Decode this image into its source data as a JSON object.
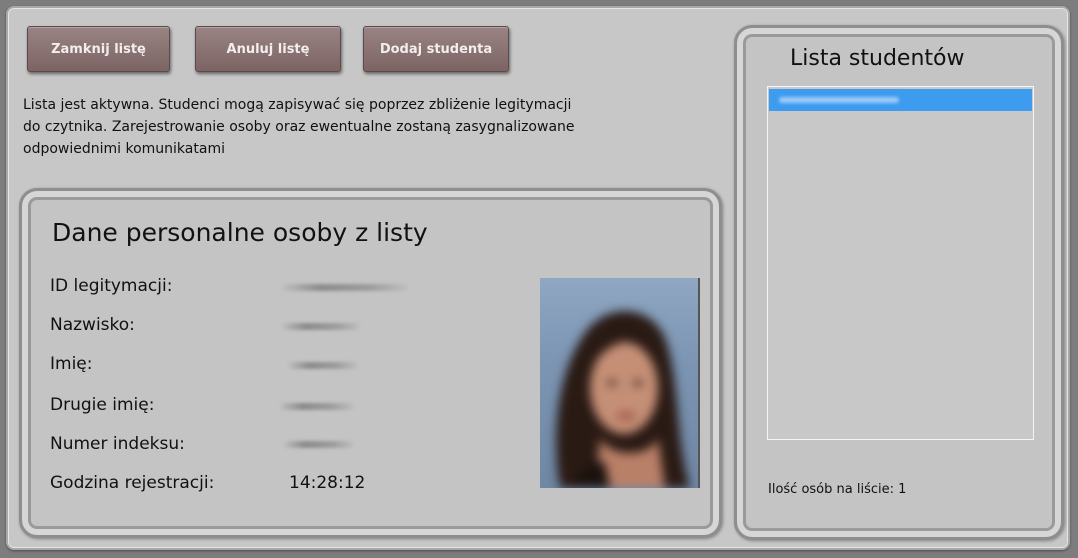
{
  "toolbar": {
    "close_list_label": "Zamknij listę",
    "cancel_list_label": "Anuluj listę",
    "add_student_label": "Dodaj studenta"
  },
  "info": {
    "line1": "Lista jest aktywna. Studenci mogą zapisywać się poprzez zbliżenie legitymacji",
    "line2": "do czytnika. Zarejestrowanie osoby oraz ewentualne zostaną zasygnalizowane",
    "line3": "odpowiednimi komunikatami"
  },
  "person": {
    "title": "Dane personalne osoby z listy",
    "fields": [
      {
        "label": "ID legitymacji:",
        "value": ""
      },
      {
        "label": "Nazwisko:",
        "value": ""
      },
      {
        "label": "Imię:",
        "value": ""
      },
      {
        "label": "Drugie imię:",
        "value": ""
      },
      {
        "label": "Numer indeksu:",
        "value": ""
      },
      {
        "label": "Godzina rejestracji:",
        "value": "14:28:12"
      }
    ]
  },
  "students": {
    "title": "Lista studentów",
    "items": [
      ""
    ],
    "count_label": "Ilość osób na liście: 1"
  },
  "colors": {
    "button": "#8b7272",
    "selection": "#3d9bf0",
    "background": "#c7c7c7"
  }
}
